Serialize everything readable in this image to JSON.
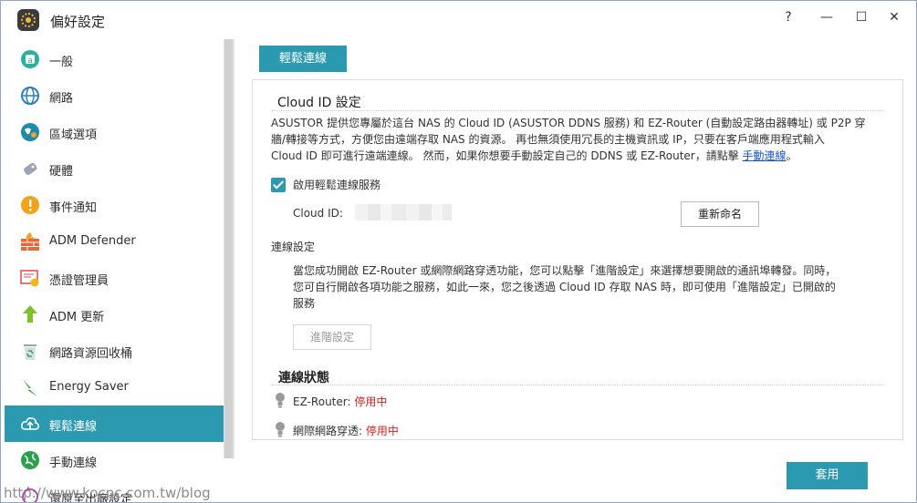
{
  "window": {
    "title": "偏好設定",
    "help": "?",
    "minimize": "—",
    "maximize": "☐",
    "close": "✕"
  },
  "sidebar": {
    "items": [
      {
        "label": "一般",
        "icon": "general-icon"
      },
      {
        "label": "網路",
        "icon": "globe-icon"
      },
      {
        "label": "區域選項",
        "icon": "region-icon"
      },
      {
        "label": "硬體",
        "icon": "hardware-icon"
      },
      {
        "label": "事件通知",
        "icon": "alert-icon"
      },
      {
        "label": "ADM Defender",
        "icon": "firewall-icon"
      },
      {
        "label": "憑證管理員",
        "icon": "certificate-icon"
      },
      {
        "label": "ADM 更新",
        "icon": "update-arrow-icon"
      },
      {
        "label": "網路資源回收桶",
        "icon": "recycle-bin-icon"
      },
      {
        "label": "Energy Saver",
        "icon": "lightning-icon"
      },
      {
        "label": "輕鬆連線",
        "icon": "cloud-upload-icon",
        "active": true
      },
      {
        "label": "手動連線",
        "icon": "network-globe-icon"
      },
      {
        "label": "還原至出廠設定",
        "icon": "restore-icon"
      }
    ]
  },
  "tab": {
    "label": "輕鬆連線"
  },
  "cloud_id": {
    "title": "Cloud ID 設定",
    "desc_line1": "ASUSTOR 提供您專屬於這台 NAS 的 Cloud ID (ASUSTOR DDNS 服務) 和 EZ-Router (自動設定路由器轉址) 或 P2P 穿",
    "desc_line2": "牆/轉接等方式，方便您由遠端存取 NAS 的資源。 再也無須使用冗長的主機資訊或 IP，只要在客戶端應用程式輸入",
    "desc_line3": "Cloud ID 即可進行遠端連線。 然而，如果你想要手動設定自己的 DDNS 或  EZ-Router，請點擊 ",
    "manual_link": "手動連線",
    "desc_end": "。",
    "enable_label": "啟用輕鬆連線服務",
    "enabled": true,
    "id_label": "Cloud ID:",
    "rename_button": "重新命名"
  },
  "connection_settings": {
    "title": "連線設定",
    "desc_line1": "當您成功開啟 EZ-Router 或網際網路穿透功能，您可以點擊「進階設定」來選擇想要開啟的通訊埠轉發。同時，",
    "desc_line2": "您可自行開啟各項功能之服務，如此一來，您之後透過 Cloud ID 存取 NAS 時，即可使用「進階設定」已開啟的",
    "desc_line3": "服務",
    "advanced_button": "進階設定"
  },
  "status": {
    "title": "連線狀態",
    "ez_router_label": "EZ-Router: ",
    "ez_router_value": "停用中",
    "punch_label": "網際網路穿透: ",
    "punch_value": "停用中"
  },
  "apply_button": "套用",
  "watermark": "http://www.kocpc.com.tw/blog",
  "colors": {
    "accent": "#2b9ab0",
    "status_stopped": "#d42020",
    "link": "#1a56c4"
  }
}
